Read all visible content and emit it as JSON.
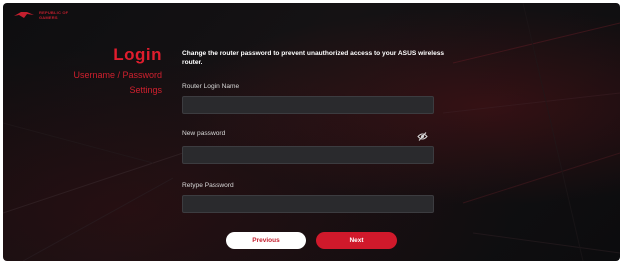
{
  "brand": {
    "logo_text": "REPUBLIC OF GAMERS",
    "icon": "rog-eye-logo-icon"
  },
  "heading": {
    "title": "Login",
    "subtitle_line1": "Username / Password",
    "subtitle_line2": "Settings"
  },
  "description": "Change the router password to prevent unauthorized access to your ASUS wireless router.",
  "form": {
    "login_name": {
      "label": "Router Login Name",
      "value": ""
    },
    "new_password": {
      "label": "New password",
      "value": "",
      "toggle_icon": "eye-slash-icon"
    },
    "retype_password": {
      "label": "Retype Password",
      "value": ""
    }
  },
  "buttons": {
    "previous": "Previous",
    "next": "Next"
  },
  "colors": {
    "accent": "#d0192b",
    "background": "#0e0e10",
    "field": "#2a2a2d"
  }
}
